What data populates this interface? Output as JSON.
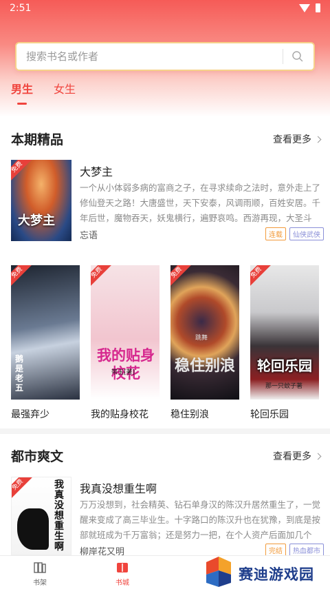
{
  "status": {
    "time": "2:51"
  },
  "search": {
    "placeholder": "搜索书名或作者"
  },
  "gender_tabs": [
    {
      "label": "男生",
      "active": true
    },
    {
      "label": "女生",
      "active": false
    }
  ],
  "sections": [
    {
      "title": "本期精品",
      "more": "查看更多",
      "featured": {
        "title": "大梦主",
        "badge": "免费",
        "cover_text": "大梦主",
        "description": "一个从小体弱多病的富商之子，在寻求续命之法时，意外走上了修仙登天之路！大唐盛世，天下安泰，风调雨顺，百姓安居。千年后世，魔物吞天，妖鬼横行，遍野哀鸣。西游再现，大圣斗天，天...",
        "author": "忘语",
        "tags": [
          {
            "label": "连载",
            "color": "#f29a3a"
          },
          {
            "label": "仙侠武侠",
            "color": "#8a8fd8"
          }
        ]
      },
      "grid": [
        {
          "title": "最强弃少",
          "badge": "免费",
          "cover_text": "鹅是老五"
        },
        {
          "title": "我的贴身校花",
          "badge": "免费",
          "cover_text": "我的贴身校花",
          "cover_sub": "带玉[著]"
        },
        {
          "title": "稳住别浪",
          "badge": "免费",
          "cover_text": "稳住别浪",
          "cover_sub": "跳舞"
        },
        {
          "title": "轮回乐园",
          "badge": "免费",
          "cover_text": "轮回乐园",
          "cover_sub": "那一只蚊子著"
        }
      ]
    },
    {
      "title": "都市爽文",
      "more": "查看更多",
      "featured": {
        "title": "我真没想重生啊",
        "badge": "免费",
        "cover_text": "我真没想重生啊",
        "description": "万万没想到，社会精英、钻石单身汉的陈汉升居然重生了，一觉醒来变成了高三毕业生。十字路口的陈汉升也在犹豫，到底是按部就班成为千万富翁；还是努力一把，在个人资产后面加几个零，并...",
        "author": "柳岸花又明",
        "tags": [
          {
            "label": "完结",
            "color": "#f29a3a"
          },
          {
            "label": "热血都市",
            "color": "#8a8fd8"
          }
        ]
      }
    }
  ],
  "bottom_nav": [
    {
      "label": "书架",
      "active": false
    },
    {
      "label": "书城",
      "active": true
    }
  ],
  "watermark": {
    "text": "赛迪游戏园"
  },
  "colors": {
    "accent": "#f0443d",
    "tag_status": "#f29a3a",
    "tag_genre": "#8a8fd8"
  }
}
